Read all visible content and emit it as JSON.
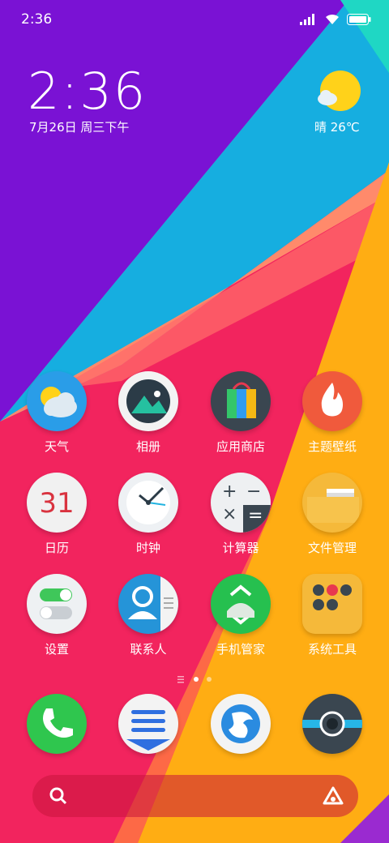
{
  "status_bar": {
    "time": "2:36"
  },
  "widget": {
    "time": "2:36",
    "date": "7月26日 周三下午",
    "weather": "晴 26℃"
  },
  "apps": [
    {
      "label": "天气",
      "icon": "weather-icon"
    },
    {
      "label": "相册",
      "icon": "gallery-icon"
    },
    {
      "label": "应用商店",
      "icon": "app-store-icon"
    },
    {
      "label": "主题壁纸",
      "icon": "themes-icon"
    },
    {
      "label": "日历",
      "icon": "calendar-icon",
      "day": "31"
    },
    {
      "label": "时钟",
      "icon": "clock-icon"
    },
    {
      "label": "计算器",
      "icon": "calculator-icon"
    },
    {
      "label": "文件管理",
      "icon": "file-manager-icon"
    },
    {
      "label": "设置",
      "icon": "settings-icon"
    },
    {
      "label": "联系人",
      "icon": "contacts-icon"
    },
    {
      "label": "手机管家",
      "icon": "security-icon"
    },
    {
      "label": "系统工具",
      "icon": "system-tools-folder-icon"
    }
  ],
  "dock": [
    {
      "icon": "phone-icon"
    },
    {
      "icon": "messages-icon"
    },
    {
      "icon": "browser-icon"
    },
    {
      "icon": "camera-icon"
    }
  ],
  "colors": {
    "purple": "#7a12d4",
    "pink": "#f2245e",
    "orange": "#ffad13",
    "cyan": "#19c3d9"
  }
}
